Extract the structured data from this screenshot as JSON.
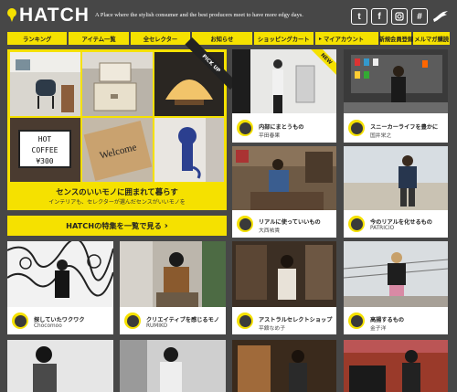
{
  "header": {
    "logo_text": "HATCH",
    "tagline": "A Place where the stylish consumer and the best producers meet to have more edgy days.",
    "social": [
      "twitter-icon",
      "facebook-icon",
      "instagram-icon",
      "hashtag-icon",
      "lark-icon"
    ]
  },
  "nav": {
    "items": [
      "ランキング",
      "アイテム一覧",
      "全セレクター",
      "お知らせ",
      "ショッピングカート"
    ],
    "account": "マイアカウント",
    "register": "新規会員登録",
    "magazine": "メルマガ購読"
  },
  "feature": {
    "ribbon": "PICK UP",
    "lightbox_text": [
      "HOT",
      "COFFEE",
      "¥300"
    ],
    "title": "センスのいいモノに囲まれて暮らす",
    "subtitle": "インテリアも、セレクターが選んだセンスがいいモノを"
  },
  "all_button": "HATCHの特集を一覧で見る",
  "cards": [
    {
      "title": "内部にまとうもの",
      "name": "平田春果",
      "new": "NEW"
    },
    {
      "title": "スニーカーライフを豊かに",
      "name": "国井栄之"
    },
    {
      "title": "リアルに使っていいもの",
      "name": "大西祐貴"
    },
    {
      "title": "今のリアルを化せるもの",
      "name": "PATRICIO"
    },
    {
      "title": "探していたワクワク",
      "name": "Chocomoo"
    },
    {
      "title": "クリエイティブを感じるモノ",
      "name": "RUMIKO"
    },
    {
      "title": "アストラルセレクトショップ",
      "name": "平舘なめ子"
    },
    {
      "title": "高揚するもの",
      "name": "金子洋"
    }
  ],
  "colors": {
    "accent": "#f5e100",
    "background": "#474747"
  }
}
